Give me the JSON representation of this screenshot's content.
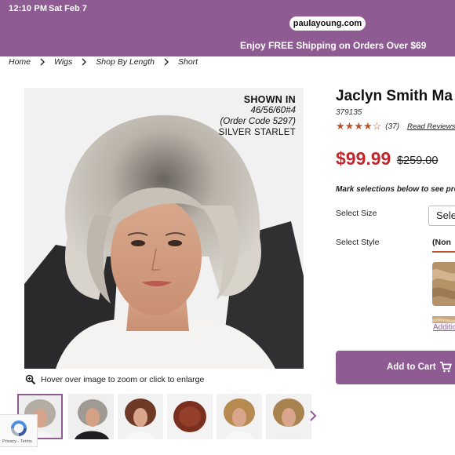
{
  "status_bar": {
    "time": "12:10 PM",
    "date": "Sat Feb 7"
  },
  "browser": {
    "url": "paulayoung.com"
  },
  "promo_banner": {
    "text": "Enjoy FREE Shipping on Orders Over $69"
  },
  "breadcrumb": [
    "Home",
    "Wigs",
    "Shop By Length",
    "Short"
  ],
  "main_image": {
    "shown_in_heading": "SHOWN IN",
    "shown_in_codes": "46/56/60#4",
    "shown_in_order_code": "(Order Code 5297)",
    "shown_in_color": "SILVER STARLET",
    "zoom_hint": "Hover over image to zoom or click to enlarge"
  },
  "recaptcha": {
    "privacy": "Privacy",
    "separator": " - ",
    "terms": "Terms"
  },
  "product": {
    "title": "Jaclyn Smith Ma",
    "sku": "379135",
    "rating": 4,
    "rating_max": 5,
    "review_count": "(37)",
    "read_reviews": "Read Reviews",
    "price": "$99.99",
    "old_price": "$259.00",
    "instruction": "Mark selections below to see pro"
  },
  "options": {
    "size_label": "Select Size",
    "size_value": "Sele",
    "style_label": "Select Style",
    "style_value": "(Non",
    "additional_link": "Additio"
  },
  "cart": {
    "label": "Add to Cart"
  },
  "colors": {
    "brand_purple": "#8f5b93",
    "price_red": "#c0272d",
    "star_orange": "#c0532d"
  },
  "icons": [
    "magnifier-zoom-icon",
    "chevron-right-icon",
    "cart-icon",
    "recaptcha-icon",
    "star-icon"
  ]
}
